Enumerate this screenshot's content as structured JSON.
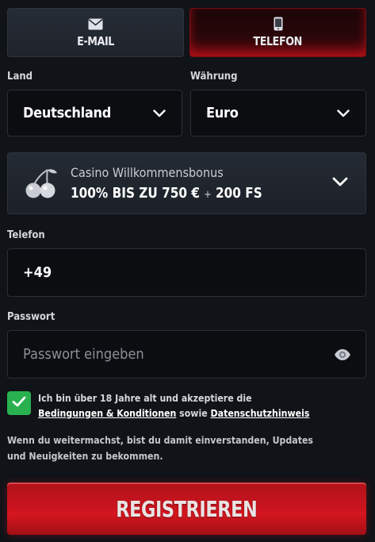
{
  "tabs": {
    "email": {
      "label": "E-MAIL",
      "icon": "envelope-icon"
    },
    "phone": {
      "label": "TELEFON",
      "icon": "smartphone-icon",
      "active": true
    }
  },
  "country": {
    "label": "Land",
    "value": "Deutschland"
  },
  "currency": {
    "label": "Währung",
    "value": "Euro"
  },
  "bonus": {
    "title": "Casino Willkommensbonus",
    "offer_main": "100% BIS ZU 750 €",
    "offer_plus": "+",
    "offer_extra": "200 FS",
    "icon": "cherry-icon"
  },
  "phone": {
    "label": "Telefon",
    "value": "+49"
  },
  "password": {
    "label": "Passwort",
    "placeholder": "Passwort eingeben",
    "icon": "eye-icon"
  },
  "terms": {
    "checked": true,
    "text_before": "Ich bin über 18 Jahre alt und akzeptiere die",
    "link_conditions": "Bedingungen & Konditionen",
    "text_middle": "sowie",
    "link_privacy": "Datenschutzhinweis"
  },
  "notice": "Wenn du weitermachst, bist du damit einverstanden, Updates und Neuigkeiten zu bekommen.",
  "register_button": "REGISTRIEREN",
  "colors": {
    "background": "#101318",
    "accent_red": "#c8141e",
    "checkbox_green": "#29b14f"
  }
}
